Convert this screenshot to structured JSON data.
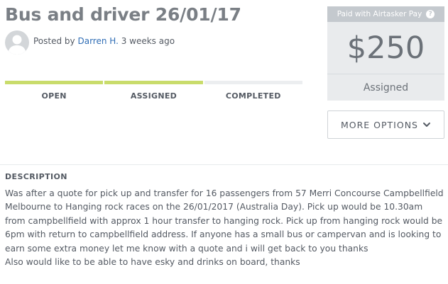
{
  "task": {
    "title": "Bus and driver 26/01/17",
    "posted_prefix": "Posted by ",
    "author": "Darren H.",
    "posted_suffix": " 3 weeks ago"
  },
  "status": {
    "steps": [
      {
        "label": "OPEN",
        "active": true
      },
      {
        "label": "ASSIGNED",
        "active": true
      },
      {
        "label": "COMPLETED",
        "active": false
      }
    ]
  },
  "price_panel": {
    "pay_tag": "Paid with Airtasker Pay",
    "help_icon": "?",
    "amount": "$250",
    "state": "Assigned"
  },
  "more_options": {
    "label": "MORE OPTIONS",
    "icon": "chevron-down-icon"
  },
  "description": {
    "heading": "DESCRIPTION",
    "paragraph_1": "Was after a quote for pick up and transfer for 16 passengers from 57 Merri Concourse Campbellfield Melbourne to Hanging rock races on the 26/01/2017 (Australia Day). Pick up would be 10.30am from campbellfield with approx 1 hour transfer to hanging rock. Pick up from hanging rock would be 6pm with return to campbellfield address. If anyone has a small bus or campervan and is looking to earn some extra money let me know with a quote and i will get back to you thanks",
    "paragraph_2": "Also would like to be able to have esky and drinks on board, thanks"
  },
  "colors": {
    "progress_active": "#c9dc6b",
    "progress_inactive": "#eceef0",
    "link": "#2f6db5",
    "panel_bg": "#e9ebed"
  }
}
